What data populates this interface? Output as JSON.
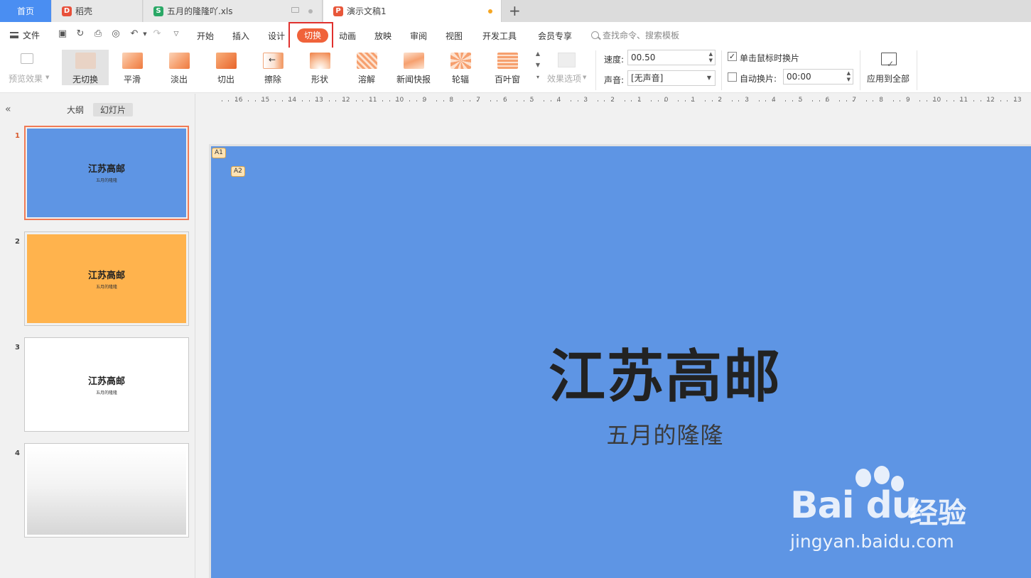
{
  "tabs": {
    "home": "首页",
    "items": [
      {
        "label": "稻壳"
      },
      {
        "label": "五月的隆隆吖.xls"
      },
      {
        "label": "演示文稿1"
      }
    ]
  },
  "menu": {
    "file": "文件",
    "items": [
      "开始",
      "插入",
      "设计",
      "切换",
      "动画",
      "放映",
      "审阅",
      "视图",
      "开发工具",
      "会员专享"
    ],
    "active": "切换",
    "search_placeholder": "查找命令、搜索模板"
  },
  "ribbon": {
    "preview": "预览效果",
    "transitions": [
      "无切换",
      "平滑",
      "淡出",
      "切出",
      "擦除",
      "形状",
      "溶解",
      "新闻快报",
      "轮辐",
      "百叶窗"
    ],
    "selected": "无切换",
    "effect_options": "效果选项",
    "speed_label": "速度:",
    "speed_value": "00.50",
    "sound_label": "声音:",
    "sound_value": "[无声音]",
    "on_click_label": "单击鼠标时换片",
    "on_click_checked": true,
    "auto_label": "自动换片:",
    "auto_checked": false,
    "auto_value": "00:00",
    "apply_all": "应用到全部"
  },
  "left_panel": {
    "tab_outline": "大纲",
    "tab_slides": "幻灯片",
    "slides": [
      {
        "num": "1",
        "title": "江苏高邮",
        "subtitle": "五月的隆隆",
        "bg": "#5e95e4"
      },
      {
        "num": "2",
        "title": "江苏高邮",
        "subtitle": "五月的隆隆",
        "bg": "#ffb34d"
      },
      {
        "num": "3",
        "title": "江苏高邮",
        "subtitle": "五月的隆隆",
        "bg": "#ffffff"
      },
      {
        "num": "4",
        "title": "",
        "subtitle": "",
        "bg": "gradient"
      }
    ]
  },
  "ruler": {
    "labels": [
      "16",
      "15",
      "14",
      "13",
      "12",
      "11",
      "10",
      "9",
      "8",
      "7",
      "6",
      "5",
      "4",
      "3",
      "2",
      "1",
      "0",
      "1",
      "2",
      "3",
      "4",
      "5",
      "6",
      "7",
      "8",
      "9",
      "10",
      "11",
      "12",
      "13"
    ]
  },
  "slide": {
    "tags": [
      "A1",
      "A2"
    ],
    "title": "江苏高邮",
    "subtitle": "五月的隆隆",
    "bg": "#5e95e4"
  },
  "watermark": {
    "logo": "Bai du",
    "jingyan": "经验",
    "url": "jingyan.baidu.com"
  }
}
